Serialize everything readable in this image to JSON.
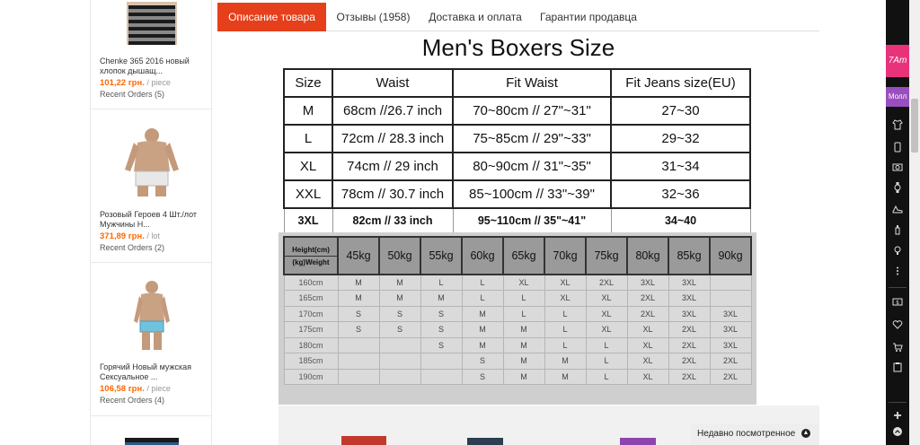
{
  "sidebar": {
    "items": [
      {
        "title": "Chenke 365 2016 новый хлопок дышащ...",
        "price": "101,22 грн.",
        "unit": "/ piece",
        "orders": "Recent Orders (5)"
      },
      {
        "title": "Розовый Героев 4 Шт./лот Мужчины Н...",
        "price": "371,89 грн.",
        "unit": "/ lot",
        "orders": "Recent Orders (2)"
      },
      {
        "title": "Горячий Новый мужская Сексуальное ...",
        "price": "106,58 грн.",
        "unit": "/ piece",
        "orders": "Recent Orders (4)"
      }
    ]
  },
  "tabs": [
    {
      "label": "Описание товара",
      "active": true
    },
    {
      "label": "Отзывы (1958)",
      "active": false
    },
    {
      "label": "Доставка и оплата",
      "active": false
    },
    {
      "label": "Гарантии продавца",
      "active": false
    }
  ],
  "size_chart": {
    "title": "Men's Boxers Size",
    "headers": [
      "Size",
      "Waist",
      "Fit Waist",
      "Fit Jeans size(EU)"
    ],
    "rows": [
      [
        "M",
        "68cm //26.7 inch",
        "70~80cm // 27\"~31\"",
        "27~30"
      ],
      [
        "L",
        "72cm // 28.3 inch",
        "75~85cm // 29\"~33\"",
        "29~32"
      ],
      [
        "XL",
        "74cm // 29 inch",
        "80~90cm // 31\"~35\"",
        "31~34"
      ],
      [
        "XXL",
        "78cm // 30.7 inch",
        "85~100cm // 33\"~39\"",
        "32~36"
      ],
      [
        "3XL",
        "82cm // 33 inch",
        "95~110cm // 35\"~41\"",
        "34~40"
      ]
    ]
  },
  "weight_chart": {
    "corner_top": "Height(cm)",
    "corner_bottom": "(kg)Weight",
    "weights": [
      "45kg",
      "50kg",
      "55kg",
      "60kg",
      "65kg",
      "70kg",
      "75kg",
      "80kg",
      "85kg",
      "90kg"
    ],
    "rows": [
      [
        "160cm",
        "M",
        "M",
        "L",
        "L",
        "XL",
        "XL",
        "2XL",
        "3XL",
        "3XL",
        ""
      ],
      [
        "165cm",
        "M",
        "M",
        "M",
        "L",
        "L",
        "XL",
        "XL",
        "2XL",
        "3XL",
        ""
      ],
      [
        "170cm",
        "S",
        "S",
        "S",
        "M",
        "L",
        "L",
        "XL",
        "2XL",
        "3XL",
        "3XL"
      ],
      [
        "175cm",
        "S",
        "S",
        "S",
        "M",
        "M",
        "L",
        "XL",
        "XL",
        "2XL",
        "3XL"
      ],
      [
        "180cm",
        "",
        "",
        "S",
        "M",
        "M",
        "L",
        "L",
        "XL",
        "2XL",
        "3XL"
      ],
      [
        "185cm",
        "",
        "",
        "",
        "S",
        "M",
        "M",
        "L",
        "XL",
        "2XL",
        "2XL"
      ],
      [
        "190cm",
        "",
        "",
        "",
        "S",
        "M",
        "M",
        "L",
        "XL",
        "2XL",
        "2XL"
      ]
    ]
  },
  "recent_bar": {
    "label": "Недавно посмотренное"
  },
  "rail": {
    "logo": "7Am",
    "mall": "Молл"
  },
  "colors": {
    "accent": "#e5401b",
    "price": "#ff6600",
    "rail": "#111111",
    "rail_logo": "#e8337b",
    "rail_mall": "#9a4fc0"
  }
}
